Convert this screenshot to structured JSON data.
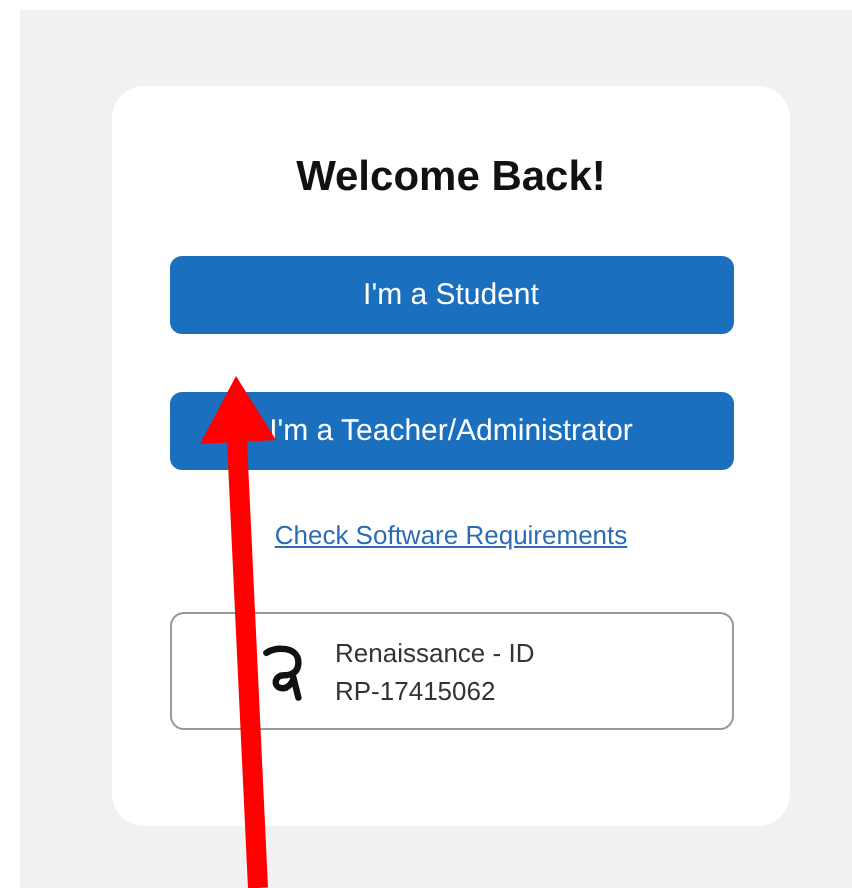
{
  "title": "Welcome Back!",
  "buttons": [
    {
      "label": "I'm a Student"
    },
    {
      "label": "I'm a Teacher/Administrator"
    }
  ],
  "link": "Check Software Requirements",
  "id_card": {
    "name": "Renaissance - ID",
    "code": "RP-17415062"
  }
}
